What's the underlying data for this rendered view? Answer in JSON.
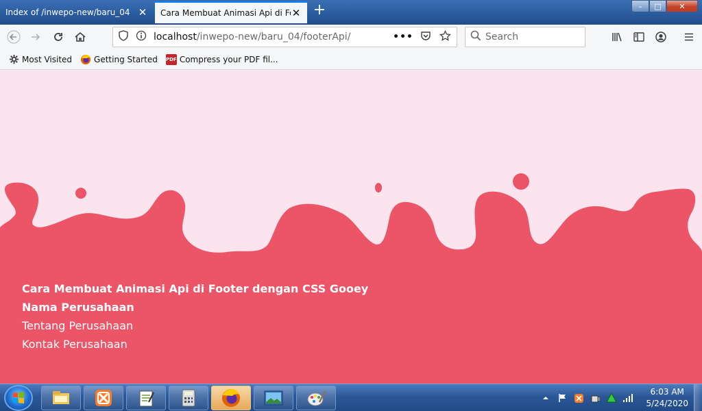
{
  "tabs": [
    {
      "title": "Index of /inwepo-new/baru_04",
      "active": false
    },
    {
      "title": "Cara Membuat Animasi Api di Footer dengan CSS Gooey",
      "active": true
    }
  ],
  "window_controls": {
    "minimize": "–",
    "maximize": "□",
    "close": "✕"
  },
  "newtab_symbol": "+",
  "address": {
    "host": "localhost",
    "path": "/inwepo-new/baru_04/footerApi/"
  },
  "search": {
    "placeholder": "Search"
  },
  "bookmarks": [
    {
      "label": "Most Visited",
      "icon": "gear-icon"
    },
    {
      "label": "Getting Started",
      "icon": "firefox-icon"
    },
    {
      "label": "Compress your PDF fil...",
      "icon": "pdf-icon",
      "badge": "PDF"
    }
  ],
  "footer": {
    "title": "Cara Membuat Animasi Api di Footer dengan CSS Gooey",
    "company": "Nama Perusahaan",
    "about": "Tentang Perusahaan",
    "contact": "Kontak Perusahaan"
  },
  "colors": {
    "page_bg": "#fce4ef",
    "footer": "#ec5567",
    "tab_accent": "#0a84ff"
  },
  "taskbar": {
    "apps": [
      "file-explorer-icon",
      "xampp-icon",
      "notepad-icon",
      "calculator-icon",
      "firefox-icon",
      "image-viewer-icon",
      "paint-icon"
    ],
    "clock_time": "6:03 AM",
    "clock_date": "5/24/2020"
  }
}
